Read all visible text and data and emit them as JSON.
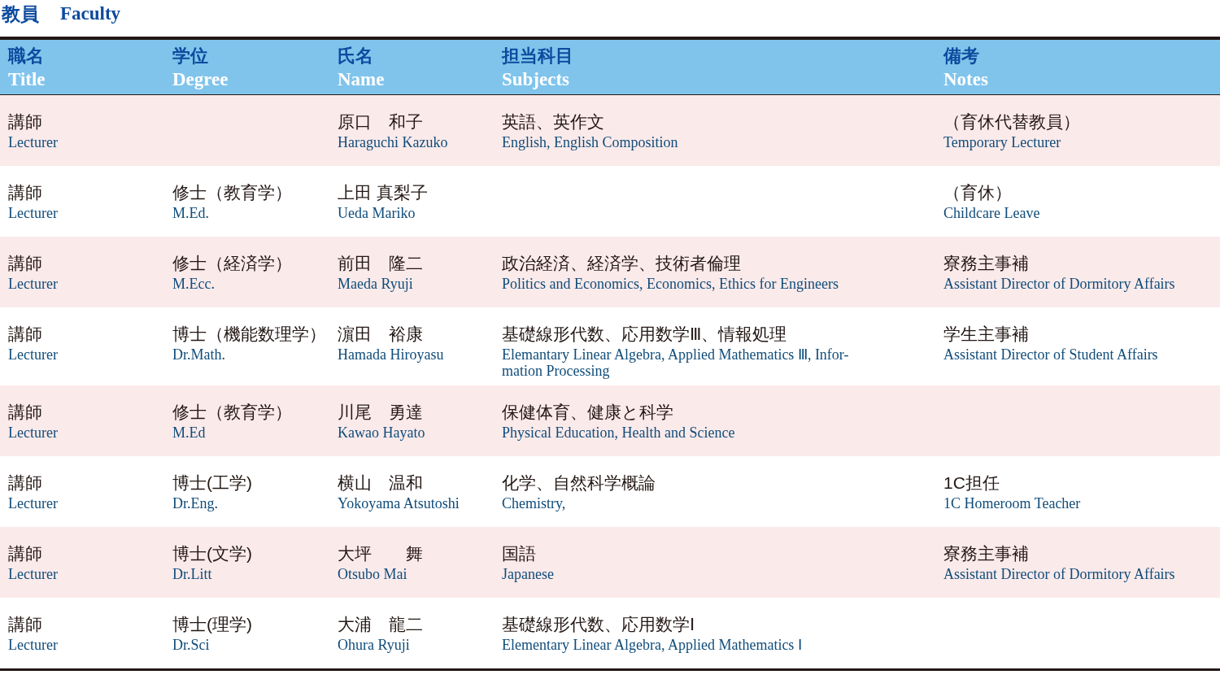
{
  "title": {
    "ja": "教員",
    "en": "Faculty"
  },
  "table": {
    "columns": [
      {
        "ja": "職名",
        "en": "Title"
      },
      {
        "ja": "学位",
        "en": "Degree"
      },
      {
        "ja": "氏名",
        "en": "Name"
      },
      {
        "ja": "担当科目",
        "en": "Subjects"
      },
      {
        "ja": "備考",
        "en": "Notes"
      }
    ],
    "rows": [
      {
        "cells": [
          {
            "ja": "講師",
            "en": "Lecturer"
          },
          {},
          {
            "ja": "原口　和子",
            "en": "Haraguchi Kazuko"
          },
          {
            "ja": "英語、英作文",
            "en": "English, English Composition"
          },
          {
            "ja": "（育休代替教員）",
            "en": "Temporary Lecturer"
          }
        ]
      },
      {
        "cells": [
          {
            "ja": "講師",
            "en": "Lecturer"
          },
          {
            "ja": "修士（教育学）",
            "en": "M.Ed."
          },
          {
            "ja": "上田 真梨子",
            "en": "Ueda Mariko"
          },
          {},
          {
            "ja": "（育休）",
            "en": "Childcare Leave"
          }
        ]
      },
      {
        "cells": [
          {
            "ja": "講師",
            "en": "Lecturer"
          },
          {
            "ja": "修士（経済学）",
            "en": "M.Ecc."
          },
          {
            "ja": "前田　隆二",
            "en": "Maeda Ryuji"
          },
          {
            "ja": "政治経済、経済学、技術者倫理",
            "en": "Politics and Economics, Economics, Ethics for Engineers"
          },
          {
            "ja": "寮務主事補",
            "en": "Assistant Director of Dormitory Affairs"
          }
        ]
      },
      {
        "cells": [
          {
            "ja": "講師",
            "en": "Lecturer"
          },
          {
            "ja": "博士（機能数理学）",
            "en": "Dr.Math."
          },
          {
            "ja": "濵田　裕康",
            "en": "Hamada Hiroyasu"
          },
          {
            "ja": "基礎線形代数、応用数学Ⅲ、情報処理",
            "en": "Elemantary Linear Algebra, Applied Mathematics Ⅲ, Infor-\nmation Processing"
          },
          {
            "ja": "学生主事補",
            "en": "Assistant Director of Student Affairs"
          }
        ]
      },
      {
        "cells": [
          {
            "ja": "講師",
            "en": "Lecturer"
          },
          {
            "ja": "修士（教育学）",
            "en": "M.Ed"
          },
          {
            "ja": "川尾　勇達",
            "en": "Kawao Hayato"
          },
          {
            "ja": "保健体育、健康と科学",
            "en": "Physical Education, Health and Science"
          },
          {}
        ]
      },
      {
        "cells": [
          {
            "ja": "講師",
            "en": "Lecturer"
          },
          {
            "ja": "博士(工学)",
            "en": "Dr.Eng."
          },
          {
            "ja": "横山　温和",
            "en": "Yokoyama Atsutoshi"
          },
          {
            "ja": "化学、自然科学概論",
            "en": "Chemistry,"
          },
          {
            "ja": "1C担任",
            "en": "1C Homeroom Teacher"
          }
        ]
      },
      {
        "cells": [
          {
            "ja": "講師",
            "en": "Lecturer"
          },
          {
            "ja": "博士(文学)",
            "en": "Dr.Litt"
          },
          {
            "ja": "大坪　　舞",
            "en": "Otsubo Mai"
          },
          {
            "ja": "国語",
            "en": "Japanese"
          },
          {
            "ja": "寮務主事補",
            "en": "Assistant Director of Dormitory Affairs"
          }
        ]
      },
      {
        "cells": [
          {
            "ja": "講師",
            "en": "Lecturer"
          },
          {
            "ja": "博士(理学)",
            "en": "Dr.Sci"
          },
          {
            "ja": "大浦　龍二",
            "en": "Ohura Ryuji"
          },
          {
            "ja": "基礎線形代数、応用数学Ⅰ",
            "en": "Elementary Linear Algebra, Applied Mathematics Ⅰ"
          },
          {}
        ]
      }
    ]
  }
}
